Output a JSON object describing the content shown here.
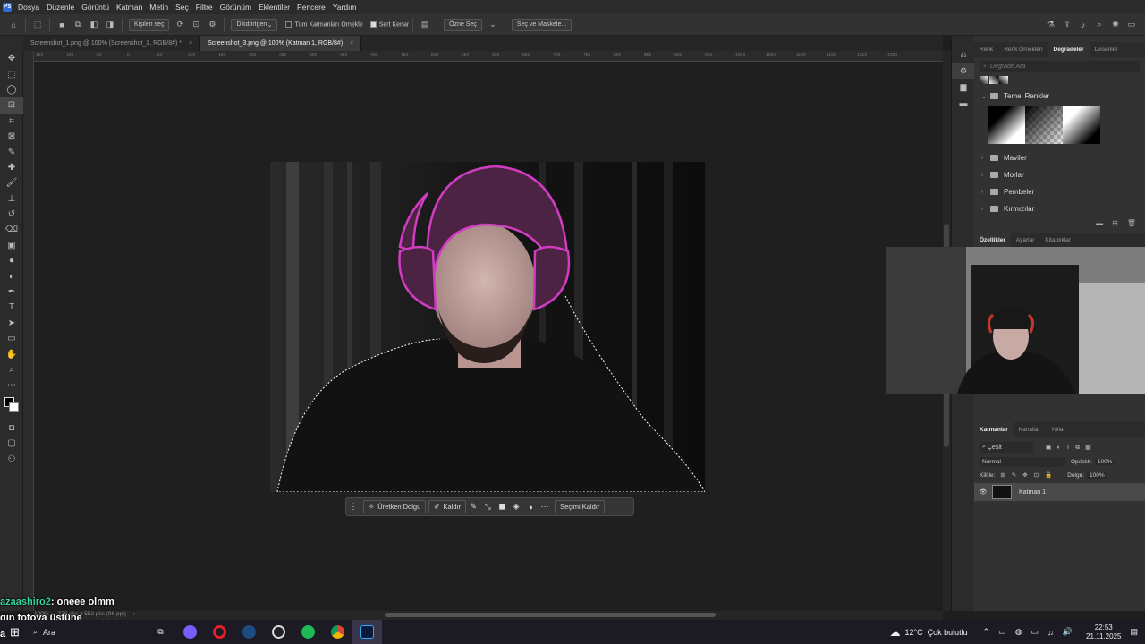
{
  "app": {
    "brand_color": "#2d6bd8"
  },
  "menu": [
    "Dosya",
    "Düzenle",
    "Görüntü",
    "Katman",
    "Metin",
    "Seç",
    "Filtre",
    "Görünüm",
    "Eklentiler",
    "Pencere",
    "Yardım"
  ],
  "options": {
    "select_subject": "Kişileri seç",
    "shape_mode": "Dikdörtgen",
    "sample_all_layers": "Tüm Katmanları Örnekle",
    "hard_edge": "Sert Kenar",
    "select_subject_btn": "Özne Seç",
    "select_and_mask": "Seç ve Maskele..."
  },
  "tabs": [
    {
      "label": "Screenshot_1.png @ 100% (Screenshot_3, RGB/8#) *",
      "active": false
    },
    {
      "label": "Screenshot_3.png @ 100% (Katman 1, RGB/8#)",
      "active": true
    }
  ],
  "ruler_ticks": [
    "150",
    "100",
    "50",
    "0",
    "50",
    "100",
    "150",
    "200",
    "250",
    "300",
    "350",
    "400",
    "450",
    "500",
    "550",
    "600",
    "650",
    "700",
    "750",
    "800",
    "850",
    "900",
    "950",
    "1000",
    "1050",
    "1100",
    "1150",
    "1200",
    "1250"
  ],
  "context_bar": {
    "generative_fill": "Üretken Dolgu",
    "remove": "Kaldır",
    "deselect": "Seçimi Kaldır"
  },
  "status": {
    "zoom": "100%",
    "size": "726 pks x 552 pks (96 ppi)"
  },
  "right_panel": {
    "top_tabs": [
      "Renk",
      "Renk Örnekleri",
      "Degradeler",
      "Desenler"
    ],
    "active_top_tab": "Degradeler",
    "gradient_search_placeholder": "Degrade Ara",
    "folders": [
      {
        "label": "Temel Renkler",
        "open": true
      },
      {
        "label": "Maviler",
        "open": false
      },
      {
        "label": "Morlar",
        "open": false
      },
      {
        "label": "Pembeler",
        "open": false
      },
      {
        "label": "Kırmızılar",
        "open": false
      }
    ],
    "mid_tabs": [
      "Özellikler",
      "Ayarlar",
      "Kitaplıklar"
    ],
    "layers_tabs": [
      "Katmanlar",
      "Kanallar",
      "Yollar"
    ],
    "layer_filter": "Çeşit",
    "blend_mode": "Normal",
    "opacity_label": "Opaklık:",
    "opacity": "100%",
    "lock_label": "Kilitle:",
    "fill_label": "Dolgu:",
    "fill": "100%",
    "layers": [
      {
        "name": "Katman 1",
        "visible": true
      }
    ]
  },
  "chat": [
    {
      "user": "azaashiro2",
      "message": ": oneee olmm",
      "user_color": "#34d399"
    },
    {
      "message": "gin fotoya üstüne"
    },
    {
      "message": "a"
    }
  ],
  "taskbar": {
    "search": "Ara",
    "weather_temp": "12°C",
    "weather_desc": "Çok bulutlu",
    "time": "22:53",
    "date": "21.11.2025",
    "weather_badge": "1"
  }
}
